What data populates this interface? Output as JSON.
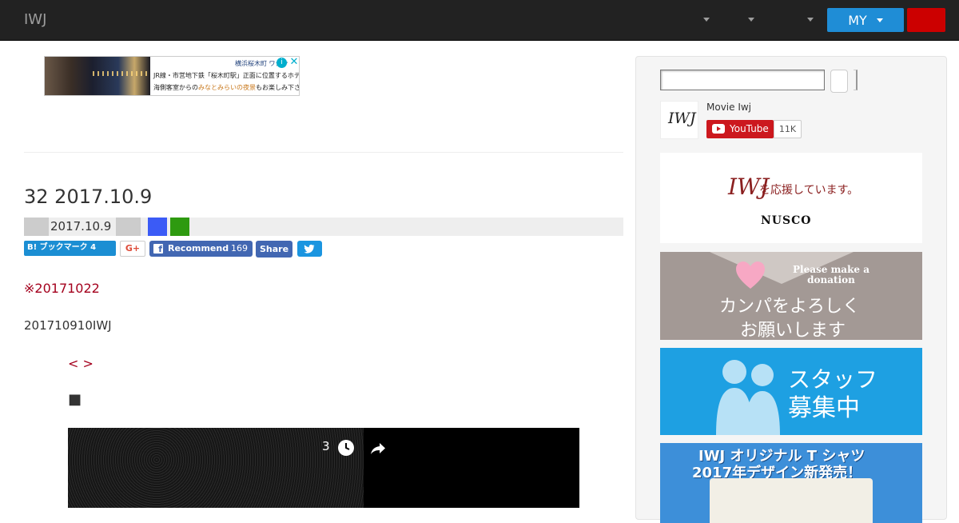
{
  "navbar": {
    "brand": "IWJ",
    "my_button": "MY",
    "accent_color": "#1f8dd6",
    "red_button_color": "#cc0000"
  },
  "ad": {
    "brand_text": "横浜桜木町 ワシン",
    "line1": "JR線・市営地下鉄「桜木町駅」正面に位置するホテルです。",
    "line2_pre": "海側客室からの",
    "line2_highlight": "みなとみらいの夜景",
    "line2_post": "もお楽しみ下さい。",
    "info": "i",
    "close": "✕"
  },
  "article": {
    "title": "32 2017.10.9",
    "date": "2017.10.9",
    "red_text": "※20171022",
    "body": "201710910IWJ",
    "nav_links": "< >",
    "bullet": "■"
  },
  "share": {
    "hatena": "B! ブックマーク 4",
    "gplus": "G+",
    "fb_label": "Recommend",
    "fb_count": "169",
    "share": "Share"
  },
  "video": {
    "count": "3"
  },
  "sidebar": {
    "youtube": {
      "channel_name": "Movie Iwj",
      "logo_text": "IWJ",
      "button_label": "YouTube",
      "subscriber_count": "11K"
    },
    "banner_nusco": {
      "logo": "IWJ",
      "tagline": "を応援しています。",
      "sponsor": "NUSCO"
    },
    "banner_donate": {
      "en": "Please make a donation",
      "jp_line1": "カンパをよろしく",
      "jp_line2": "お願いします"
    },
    "banner_staff": {
      "jp_line1": "スタッフ",
      "jp_line2": "募集中"
    },
    "banner_tshirt": {
      "line1": "IWJ オリジナル T シャツ",
      "line2": "2017年デザイン新発売！"
    }
  }
}
